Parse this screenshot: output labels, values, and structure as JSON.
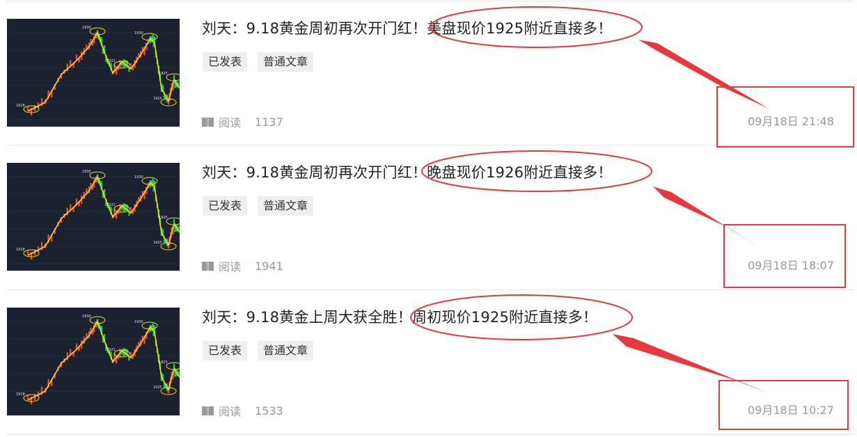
{
  "articles": [
    {
      "title_prefix": "刘天：9.18黄金周初再次开门红！",
      "title_highlight": "美盘现价1925附近直接多！",
      "tags": [
        "已发表",
        "普通文章"
      ],
      "read_label": "阅读",
      "read_count": "1137",
      "time": "09月18日 21:48"
    },
    {
      "title_prefix": "刘天：9.18黄金周初再次开门红！",
      "title_highlight": "晚盘现价1926附近直接多！",
      "tags": [
        "已发表",
        "普通文章"
      ],
      "read_label": "阅读",
      "read_count": "1941",
      "time": "09月18日 18:07"
    },
    {
      "title_prefix": "刘天：9.18黄金上周大获全胜！",
      "title_highlight": "周初现价1925附近直接多！",
      "tags": [
        "已发表",
        "普通文章"
      ],
      "read_label": "阅读",
      "read_count": "1533",
      "time": "09月18日 10:27"
    }
  ],
  "thumbnail_labels": [
    "1930",
    "1930",
    "1921",
    "1925",
    "1925",
    "1918"
  ],
  "colors": {
    "annotation_red": "#e8383d",
    "thumb_bg": "#1a2230",
    "candle_up": "#ef4444",
    "candle_down": "#22c55e",
    "trend_line": "#f5e012"
  },
  "icons": [
    "book-icon"
  ]
}
